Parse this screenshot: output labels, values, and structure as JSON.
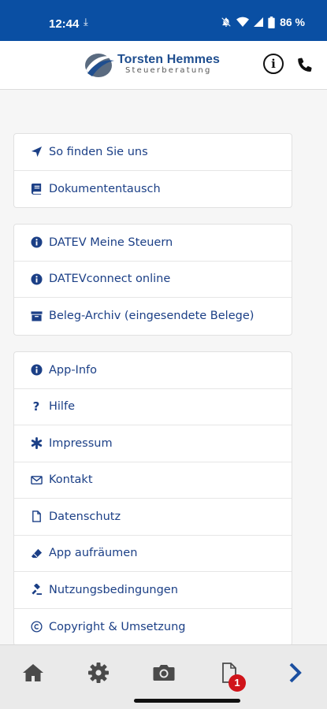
{
  "status": {
    "time": "12:44",
    "battery": "86 %"
  },
  "header": {
    "logo_name": "Torsten Hemmes",
    "logo_sub": "Steuerberatung"
  },
  "groups": [
    {
      "items": [
        {
          "label": "So finden Sie uns",
          "icon": "location-arrow-icon"
        },
        {
          "label": "Dokumententausch",
          "icon": "book-icon"
        }
      ]
    },
    {
      "items": [
        {
          "label": "DATEV Meine Steuern",
          "icon": "info-circle-icon"
        },
        {
          "label": "DATEVconnect online",
          "icon": "info-circle-icon"
        },
        {
          "label": "Beleg-Archiv (eingesendete Belege)",
          "icon": "archive-icon"
        }
      ]
    },
    {
      "items": [
        {
          "label": "App-Info",
          "icon": "info-circle-icon"
        },
        {
          "label": "Hilfe",
          "icon": "question-icon"
        },
        {
          "label": "Impressum",
          "icon": "asterisk-icon"
        },
        {
          "label": "Kontakt",
          "icon": "envelope-icon"
        },
        {
          "label": "Datenschutz",
          "icon": "file-icon"
        },
        {
          "label": "App aufräumen",
          "icon": "eraser-icon"
        },
        {
          "label": "Nutzungsbedingungen",
          "icon": "gavel-icon"
        },
        {
          "label": "Copyright & Umsetzung",
          "icon": "copyright-icon"
        }
      ]
    }
  ],
  "nav": {
    "badge_count": "1"
  },
  "colors": {
    "statusbar": "#0a4fa3",
    "link": "#1b3f86",
    "badge": "#d0141a"
  }
}
